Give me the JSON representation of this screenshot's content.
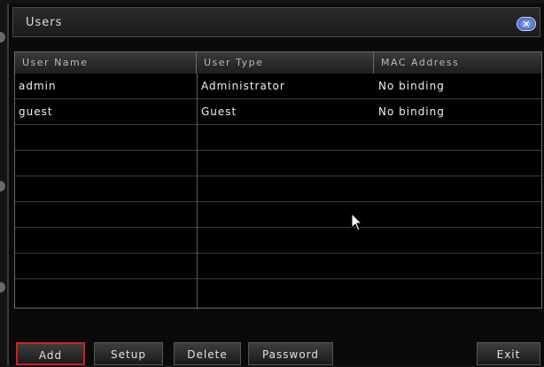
{
  "window": {
    "title": "Users"
  },
  "table": {
    "columns": [
      "User Name",
      "User Type",
      "MAC Address"
    ],
    "rows": [
      {
        "name": "admin",
        "type": "Administrator",
        "mac": "No binding"
      },
      {
        "name": "guest",
        "type": "Guest",
        "mac": "No binding"
      }
    ]
  },
  "buttons": {
    "add": "Add",
    "setup": "Setup",
    "delete": "Delete",
    "password": "Password",
    "exit": "Exit"
  },
  "colors": {
    "focus_border": "#d02020",
    "close_button": "#2b4aa8"
  },
  "icons": {
    "close": "close-icon",
    "cursor": "mouse-pointer-icon"
  }
}
